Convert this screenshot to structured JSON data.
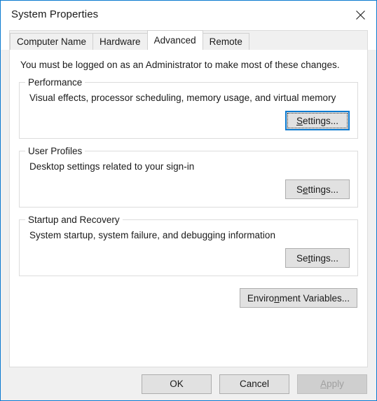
{
  "window": {
    "title": "System Properties",
    "accent_color": "#0b7ad0",
    "close_icon": "close-icon"
  },
  "tabs": [
    {
      "label": "Computer Name",
      "active": false
    },
    {
      "label": "Hardware",
      "active": false
    },
    {
      "label": "Advanced",
      "active": true
    },
    {
      "label": "Remote",
      "active": false
    }
  ],
  "panel": {
    "intro": "You must be logged on as an Administrator to make most of these changes.",
    "groups": [
      {
        "legend": "Performance",
        "description": "Visual effects, processor scheduling, memory usage, and virtual memory",
        "button": {
          "label": "Settings...",
          "accel_before": "",
          "accel": "S",
          "accel_after": "ettings...",
          "focused": true,
          "disabled": false
        }
      },
      {
        "legend": "User Profiles",
        "description": "Desktop settings related to your sign-in",
        "button": {
          "label": "Settings...",
          "accel_before": "S",
          "accel": "e",
          "accel_after": "ttings...",
          "focused": false,
          "disabled": false
        }
      },
      {
        "legend": "Startup and Recovery",
        "description": "System startup, system failure, and debugging information",
        "button": {
          "label": "Settings...",
          "accel_before": "Se",
          "accel": "t",
          "accel_after": "tings...",
          "focused": false,
          "disabled": false
        }
      }
    ],
    "environment_button": {
      "label": "Environment Variables...",
      "accel_before": "Enviro",
      "accel": "n",
      "accel_after": "ment Variables..."
    }
  },
  "footer": {
    "ok": {
      "label": "OK",
      "accel_before": "OK",
      "accel": "",
      "accel_after": "",
      "disabled": false
    },
    "cancel": {
      "label": "Cancel",
      "accel_before": "Cancel",
      "accel": "",
      "accel_after": "",
      "disabled": false
    },
    "apply": {
      "label": "Apply",
      "accel_before": "",
      "accel": "A",
      "accel_after": "pply",
      "disabled": true
    }
  }
}
